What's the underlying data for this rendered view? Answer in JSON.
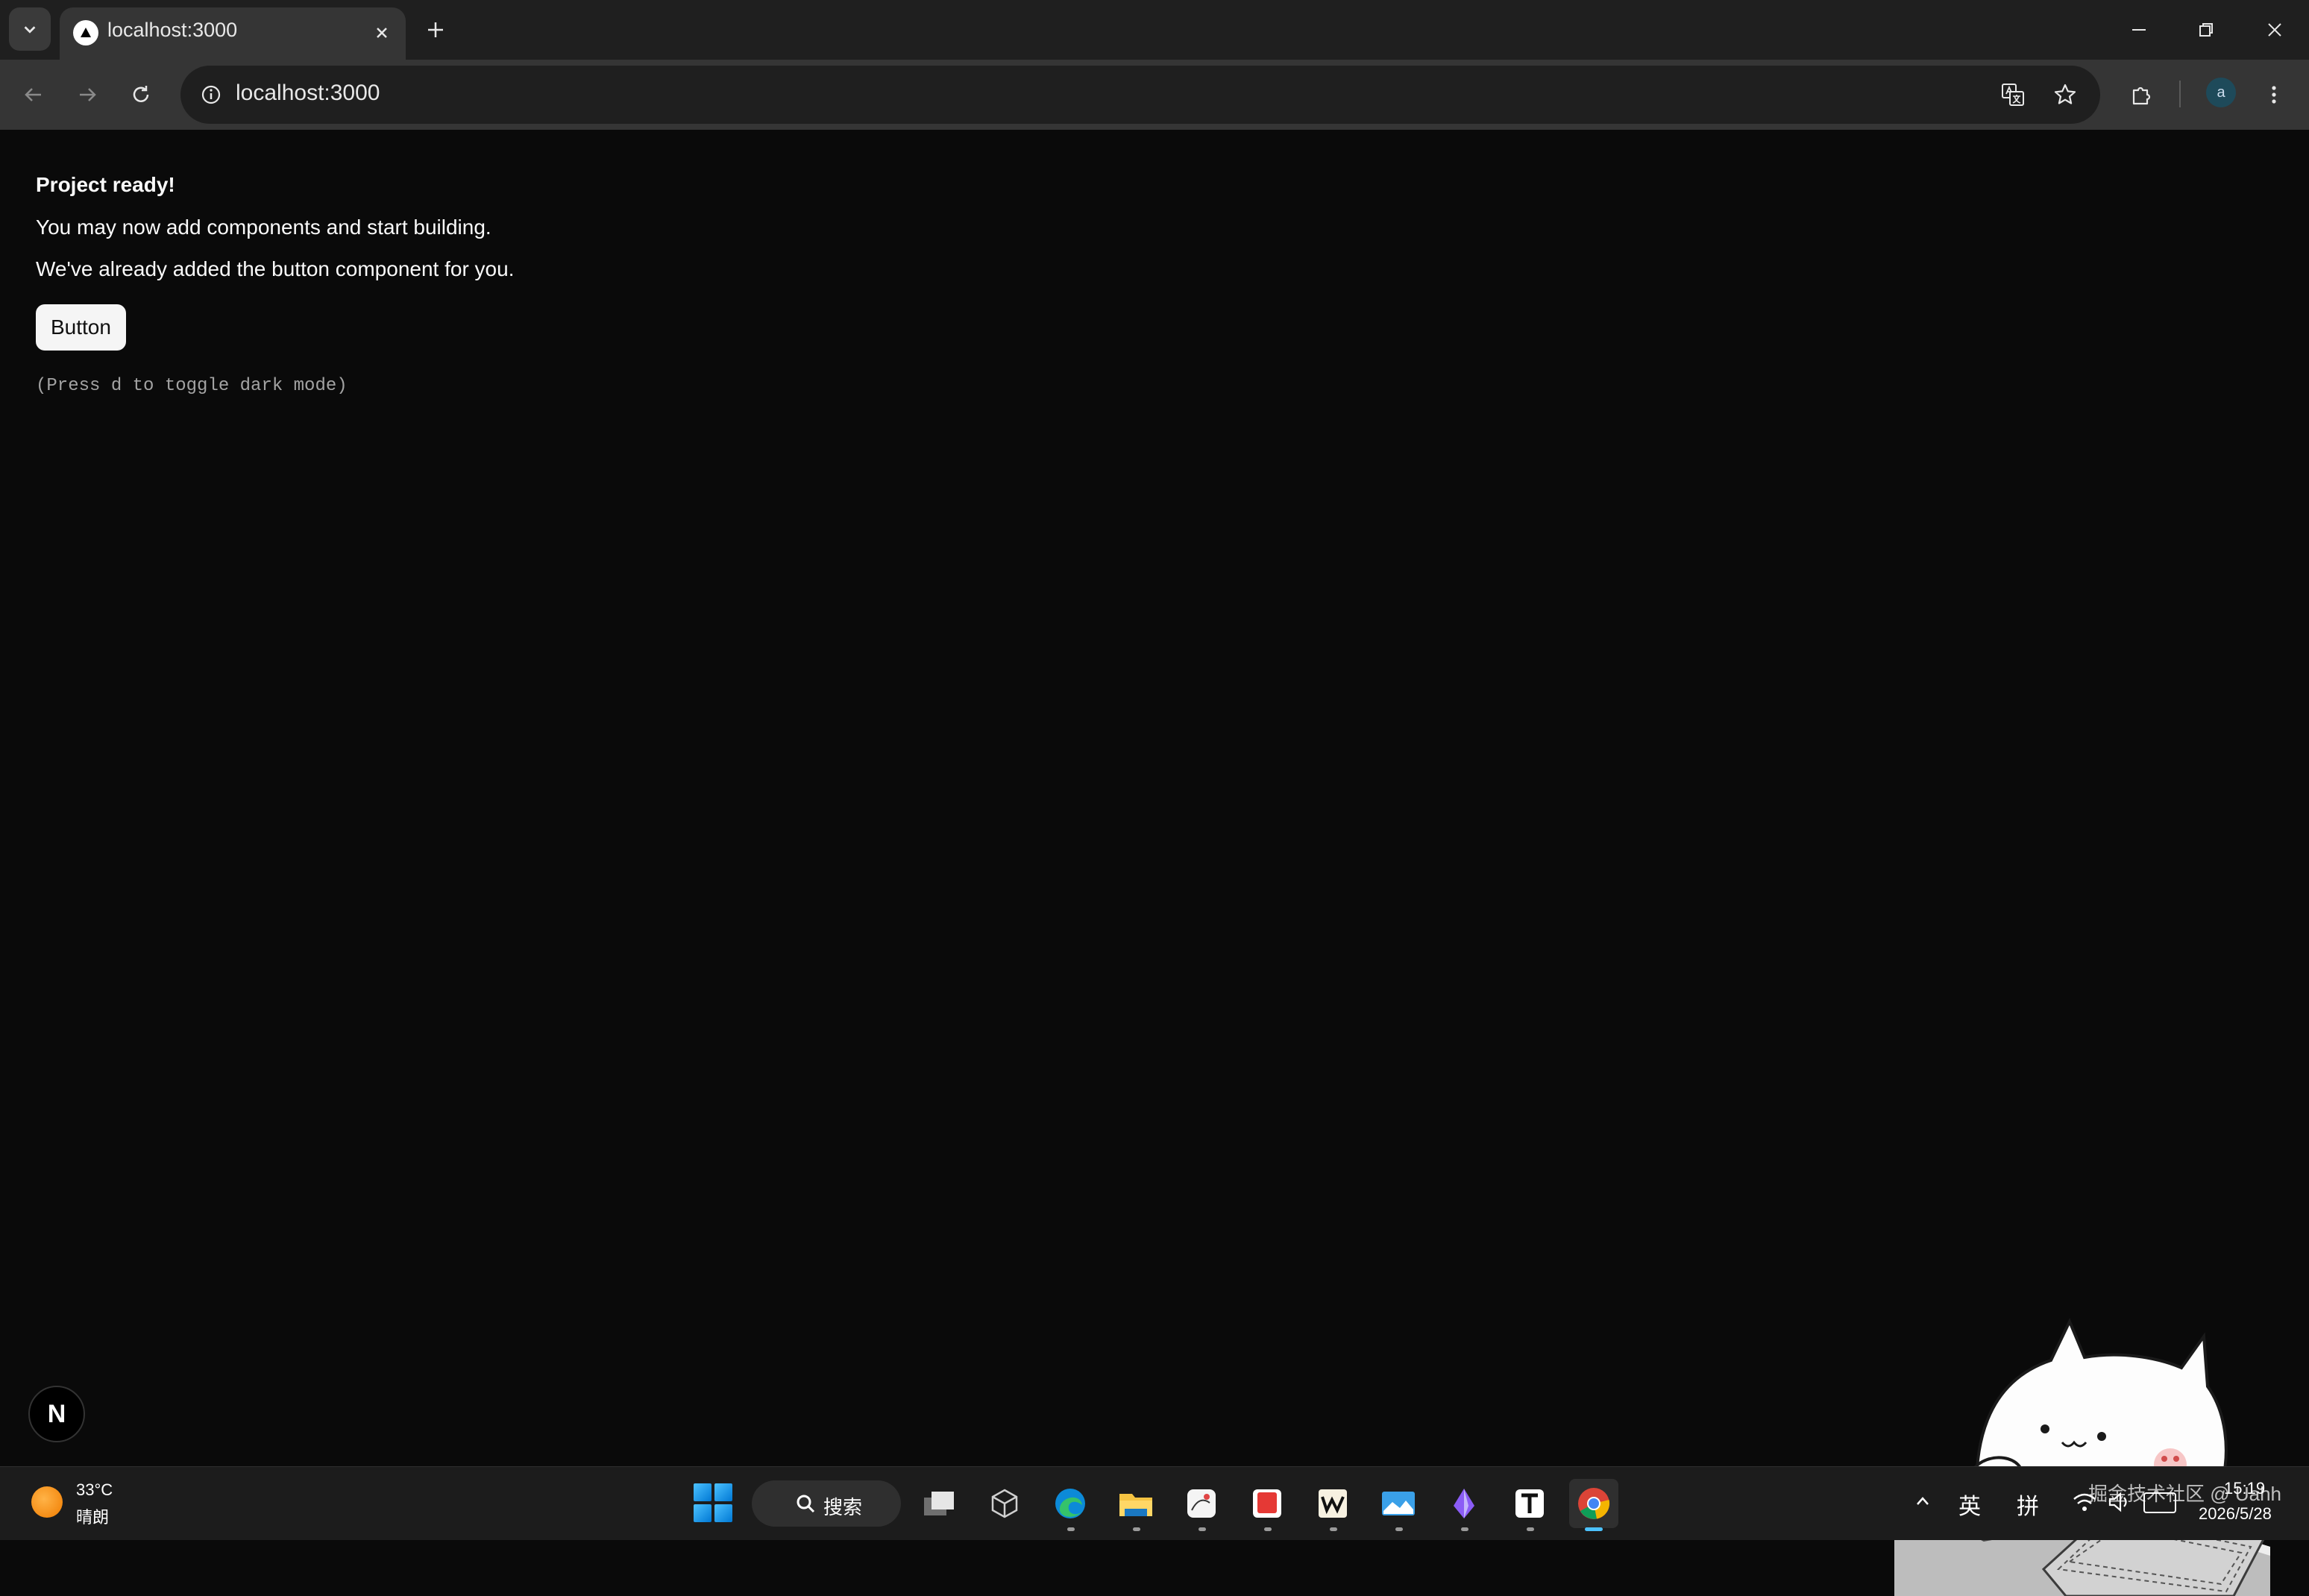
{
  "browser": {
    "tab_title": "localhost:3000",
    "url": "localhost:3000",
    "profile_initial": "a"
  },
  "page": {
    "heading": "Project ready!",
    "line1": "You may now add components and start building.",
    "line2": "We've already added the button component for you.",
    "button_label": "Button",
    "hint": "(Press d to toggle dark mode)",
    "dev_badge": "N"
  },
  "taskbar": {
    "weather_temp": "33°C",
    "weather_desc": "晴朗",
    "search_label": "搜索",
    "ime_lang": "英",
    "ime_mode": "拼",
    "time": "15:19",
    "date": "2026/5/28",
    "watermark": "掘金技术社区 @ Uahh",
    "apps": [
      "task-view",
      "3d-app",
      "edge",
      "file-explorer",
      "notes-app",
      "red-app",
      "writer-app",
      "photos-app",
      "purple-app",
      "typora",
      "chrome"
    ]
  },
  "colors": {
    "page_bg": "#0a0a0a",
    "chrome_dark": "#1f1f1f",
    "chrome_toolbar": "#353535",
    "button_bg": "#f5f5f5",
    "accent": "#4cc2ff"
  }
}
